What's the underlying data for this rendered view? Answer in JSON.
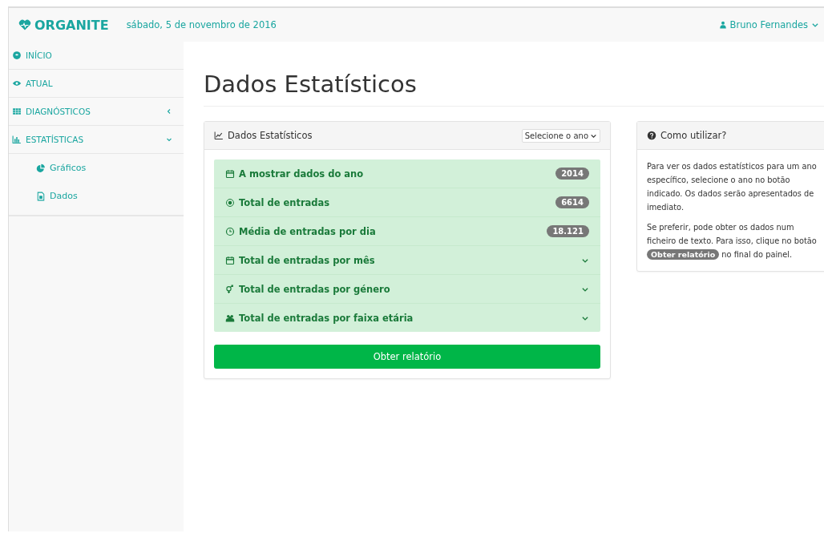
{
  "navbar": {
    "brand": "ORGANITE",
    "date": "sábado, 5 de novembro de 2016",
    "user": "Bruno Fernandes"
  },
  "sidebar": {
    "items": [
      {
        "label": "INÍCIO"
      },
      {
        "label": "ATUAL"
      },
      {
        "label": "DIAGNÓSTICOS",
        "expanded": false
      },
      {
        "label": "ESTATÍSTICAS",
        "expanded": true,
        "children": [
          {
            "label": "Gráficos"
          },
          {
            "label": "Dados"
          }
        ]
      }
    ]
  },
  "page_title": "Dados Estatísticos",
  "stats_panel": {
    "title": "Dados Estatísticos",
    "year_select": "Selecione o ano",
    "rows": [
      {
        "kind": "badge",
        "label": "A mostrar dados do ano",
        "badge": "2014"
      },
      {
        "kind": "badge",
        "label": "Total de entradas",
        "badge": "6614"
      },
      {
        "kind": "badge",
        "label": "Média de entradas por dia",
        "badge": "18.121"
      },
      {
        "kind": "expandable",
        "label": "Total de entradas por mês"
      },
      {
        "kind": "expandable",
        "label": "Total de entradas por género"
      },
      {
        "kind": "expandable",
        "label": "Total de entradas por faixa etária"
      }
    ],
    "button": "Obter relatório"
  },
  "help_panel": {
    "title": "Como utilizar?",
    "paragraph_1": "Para ver os dados estatísticos para um ano específico, selecione o ano no botão indicado. Os dados serão apresentados de imediato.",
    "paragraph_2": {
      "before": "Se preferir, pode obter os dados num ficheiro de texto. Para isso, clique no botão",
      "badge": "Obter relatório",
      "after": "no final do painel."
    }
  }
}
